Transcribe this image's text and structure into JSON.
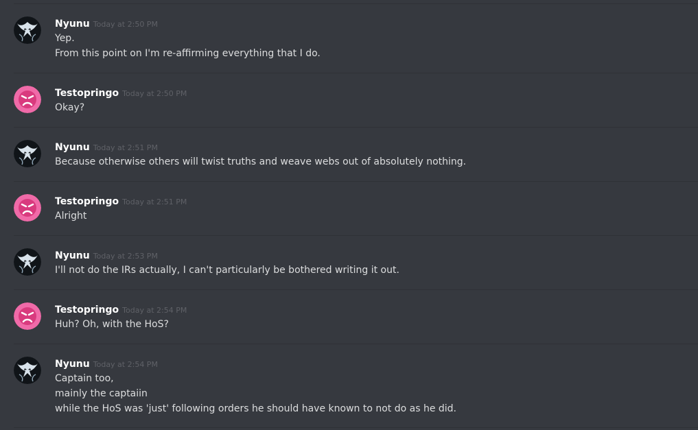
{
  "messages": [
    {
      "author": "Nyunu",
      "avatar": "venom-symbiote-avatar",
      "timestamp": "Today at 2:50 PM",
      "lines": [
        "Yep.",
        "From this point on I'm re-affirming everything that I do."
      ]
    },
    {
      "author": "Testopringo",
      "avatar": "pink-angry-face-avatar",
      "timestamp": "Today at 2:50 PM",
      "lines": [
        "Okay?"
      ]
    },
    {
      "author": "Nyunu",
      "avatar": "venom-symbiote-avatar",
      "timestamp": "Today at 2:51 PM",
      "lines": [
        "Because otherwise others will twist truths and weave webs out of absolutely nothing."
      ]
    },
    {
      "author": "Testopringo",
      "avatar": "pink-angry-face-avatar",
      "timestamp": "Today at 2:51 PM",
      "lines": [
        "Alright"
      ]
    },
    {
      "author": "Nyunu",
      "avatar": "venom-symbiote-avatar",
      "timestamp": "Today at 2:53 PM",
      "lines": [
        "I'll not do the IRs actually, I can't particularly be bothered writing it out."
      ]
    },
    {
      "author": "Testopringo",
      "avatar": "pink-angry-face-avatar",
      "timestamp": "Today at 2:54 PM",
      "lines": [
        "Huh? Oh, with the HoS?"
      ]
    },
    {
      "author": "Nyunu",
      "avatar": "venom-symbiote-avatar",
      "timestamp": "Today at 2:54 PM",
      "lines": [
        "Captain too,",
        "mainly the captaiin",
        "while the HoS was 'just' following orders he should have known to not do as he did."
      ]
    }
  ],
  "colors": {
    "background": "#36393f",
    "divider": "#2f3136",
    "username": "#ffffff",
    "timestamp": "#5f6167",
    "message_text": "#dcddde",
    "nyunu_avatar_bg": "#101418",
    "testopringo_avatar_bg": "#f06aa8"
  }
}
